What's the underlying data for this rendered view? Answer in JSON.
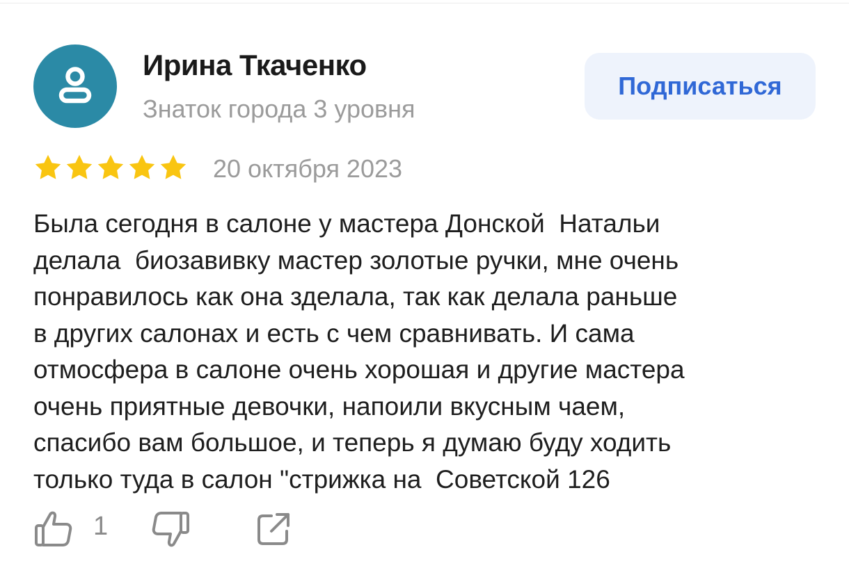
{
  "author": {
    "name": "Ирина Ткаченко",
    "level": "Знаток города 3 уровня",
    "avatar_icon": "user-icon",
    "avatar_color": "#2b8aa6"
  },
  "subscribe": {
    "label": "Подписаться",
    "color": "#3068d6",
    "background": "#eef3fc"
  },
  "review": {
    "rating": 5,
    "rating_max": 5,
    "star_color": "#f9c511",
    "date": "20 октября 2023",
    "lines": [
      "Была сегодня в салоне у мастера Донской  Натальи",
      "делала  биозавивку мастер золотые ручки, мне очень",
      "понравилось как она зделала, так как делала раньше",
      "в других салонах и есть с чем сравнивать. И сама",
      "отмосфера в салоне очень хорошая и другие мастера",
      "очень приятные девочки, напоили вкусным чаем,",
      "спасибо вам большое, и теперь я думаю буду ходить",
      "только туда в салон \"стрижка на  Советской 126"
    ]
  },
  "actions": {
    "like_icon": "thumbs-up-icon",
    "like_count": "1",
    "dislike_icon": "thumbs-down-icon",
    "share_icon": "share-icon",
    "icon_color": "#8a8a8a"
  }
}
